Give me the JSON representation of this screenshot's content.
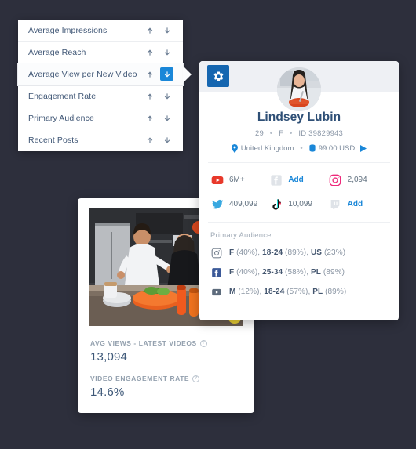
{
  "background_color": "#2d2f3c",
  "accent_color": "#1a87d8",
  "sort_list": {
    "name": "metric-sort-list",
    "rows": [
      {
        "label": "Average Impressions",
        "selected": false,
        "active_dir": ""
      },
      {
        "label": "Average Reach",
        "selected": false,
        "active_dir": ""
      },
      {
        "label": "Average View per New Video",
        "selected": true,
        "active_dir": "down"
      },
      {
        "label": "Engagement Rate",
        "selected": false,
        "active_dir": ""
      },
      {
        "label": "Primary Audience",
        "selected": false,
        "active_dir": ""
      },
      {
        "label": "Recent Posts",
        "selected": false,
        "active_dir": ""
      }
    ]
  },
  "profile": {
    "gear_icon": "gear-icon",
    "avatar_alt": "woman-cooking-avatar",
    "name": "Lindsey Lubin",
    "age": "29",
    "gender": "F",
    "id": "ID 39829943",
    "separator": "•",
    "location": "United Kingdom",
    "price": "99.00 USD",
    "location_icon": "location-pin-icon",
    "price_icon": "money-icon",
    "expand_icon": "play-arrow-icon",
    "socials": [
      {
        "network": "youtube",
        "icon": "youtube-icon",
        "value": "6M+",
        "is_add": false
      },
      {
        "network": "facebook",
        "icon": "facebook-icon",
        "value": "Add",
        "is_add": true
      },
      {
        "network": "instagram",
        "icon": "instagram-icon",
        "value": "2,094",
        "is_add": false
      },
      {
        "network": "twitter",
        "icon": "twitter-icon",
        "value": "409,099",
        "is_add": false
      },
      {
        "network": "tiktok",
        "icon": "tiktok-icon",
        "value": "10,099",
        "is_add": false
      },
      {
        "network": "twitch",
        "icon": "twitch-icon",
        "value": "Add",
        "is_add": true
      }
    ],
    "audience_title": "Primary Audience",
    "audience": [
      {
        "network": "instagram",
        "icon": "instagram-icon",
        "gender": "F",
        "gender_pct": "(40%)",
        "age": "18-24",
        "age_pct": "(89%)",
        "country": "US",
        "country_pct": "(23%)"
      },
      {
        "network": "facebook",
        "icon": "facebook-icon",
        "gender": "F",
        "gender_pct": "(40%)",
        "age": "25-34",
        "age_pct": "(58%)",
        "country": "PL",
        "country_pct": "(89%)"
      },
      {
        "network": "youtube",
        "icon": "youtube-icon",
        "gender": "M",
        "gender_pct": "(12%)",
        "age": "18-24",
        "age_pct": "(57%)",
        "country": "PL",
        "country_pct": "(89%)"
      }
    ]
  },
  "media_card": {
    "photo_alt": "couple-cooking-in-kitchen",
    "stats": [
      {
        "label": "AVG VIEWS - LATEST VIDEOS",
        "value": "13,094",
        "help": "?"
      },
      {
        "label": "VIDEO ENGAGEMENT RATE",
        "value": "14.6%",
        "help": "?"
      }
    ]
  }
}
